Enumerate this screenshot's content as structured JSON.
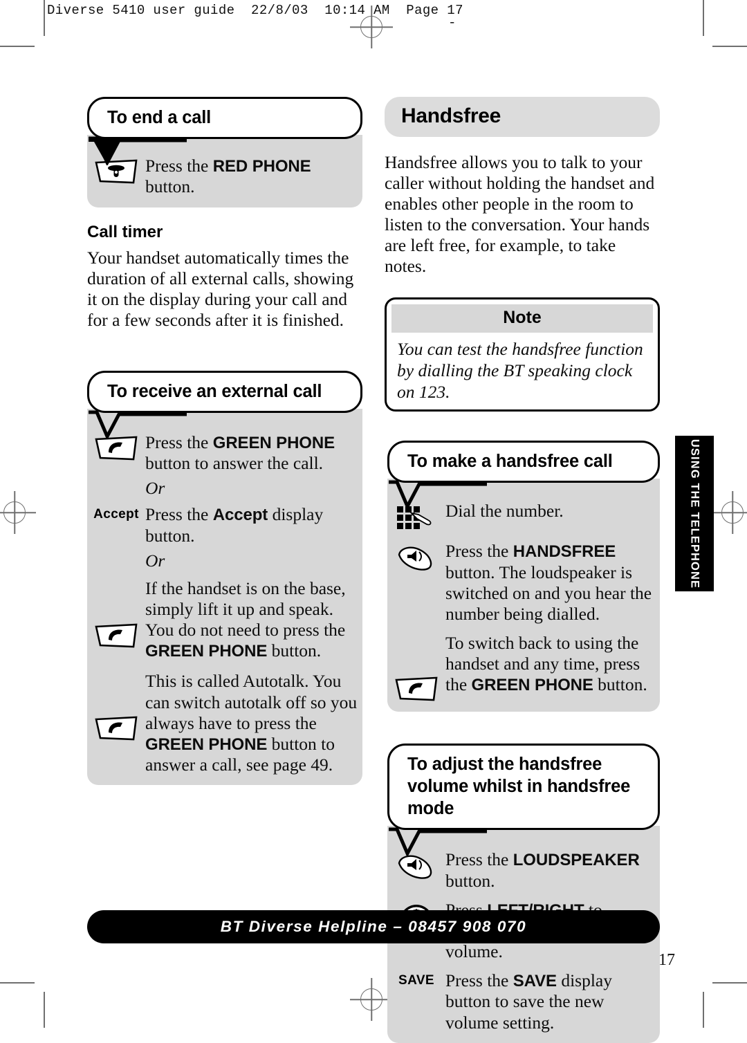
{
  "running_head": "Diverse 5410 user guide  22/8/03  10:14 AM  Page 17",
  "dash_mark": "-",
  "page_number": "17",
  "side_tab": {
    "label": "USING THE TELEPHONE"
  },
  "footer": {
    "text": "BT Diverse Helpline – 08457 908 070"
  },
  "left_column": {
    "section1": {
      "heading": "To end a call",
      "rows": [
        {
          "icon": "red-phone-button-icon",
          "text_parts": [
            {
              "t": "Press the ",
              "style": "normal"
            },
            {
              "t": "RED PHONE",
              "style": "bold"
            },
            {
              "t": " button.",
              "style": "normal"
            }
          ]
        }
      ]
    },
    "call_timer": {
      "subheading": "Call timer",
      "paragraph": "Your handset automatically times the duration of all external calls, showing it on the display during your call and for a few seconds after it is finished."
    },
    "section2": {
      "heading": "To receive an external call",
      "rows": [
        {
          "icon": "green-phone-button-icon",
          "text_parts": [
            {
              "t": "Press the ",
              "style": "normal"
            },
            {
              "t": "GREEN PHONE",
              "style": "bold"
            },
            {
              "t": " button to answer the call.",
              "style": "normal"
            }
          ]
        },
        {
          "icon": "none",
          "text_parts": [
            {
              "t": "Or",
              "style": "italic"
            }
          ]
        },
        {
          "icon": "accept-display-label",
          "icon_label": "Accept",
          "text_parts": [
            {
              "t": "Press the ",
              "style": "normal"
            },
            {
              "t": "Accept",
              "style": "bold"
            },
            {
              "t": " display button.",
              "style": "normal"
            }
          ]
        },
        {
          "icon": "none",
          "text_parts": [
            {
              "t": "Or",
              "style": "italic"
            }
          ]
        },
        {
          "icon": "green-phone-button-icon",
          "text_parts": [
            {
              "t": "If the handset is on the base, simply lift it up and speak. You do not need to press the ",
              "style": "normal"
            },
            {
              "t": "GREEN PHONE",
              "style": "bold"
            },
            {
              "t": " button.",
              "style": "normal"
            }
          ]
        },
        {
          "icon": "green-phone-button-icon",
          "text_parts": [
            {
              "t": "This is called Autotalk. You can switch autotalk off so you always have to press the ",
              "style": "normal"
            },
            {
              "t": "GREEN PHONE",
              "style": "bold"
            },
            {
              "t": " button to answer a call, see page 49.",
              "style": "normal"
            }
          ]
        }
      ]
    }
  },
  "right_column": {
    "title": "Handsfree",
    "intro": "Handsfree allows you to talk to your caller without holding the handset and enables other people in the room to listen to the conversation. Your hands are left free, for example, to take notes.",
    "note": {
      "header": "Note",
      "body": "You can test the handsfree function by dialling the BT speaking clock on 123."
    },
    "section1": {
      "heading": "To make a handsfree call",
      "rows": [
        {
          "icon": "keypad-icon",
          "text_parts": [
            {
              "t": "Dial the number.",
              "style": "normal"
            }
          ]
        },
        {
          "icon": "loudspeaker-icon",
          "text_parts": [
            {
              "t": "Press the ",
              "style": "normal"
            },
            {
              "t": "HANDSFREE",
              "style": "bold"
            },
            {
              "t": " button. The loudspeaker is switched on and you hear the number being dialled.",
              "style": "normal"
            }
          ]
        },
        {
          "icon": "green-phone-button-icon",
          "text_parts": [
            {
              "t": "To switch back to using the handset and any time, press the ",
              "style": "normal"
            },
            {
              "t": "GREEN PHONE",
              "style": "bold"
            },
            {
              "t": " button.",
              "style": "normal"
            }
          ]
        }
      ]
    },
    "section2": {
      "heading": "To adjust the handsfree volume whilst in handsfree mode",
      "rows": [
        {
          "icon": "loudspeaker-icon",
          "text_parts": [
            {
              "t": "Press the ",
              "style": "normal"
            },
            {
              "t": "LOUDSPEAKER",
              "style": "bold"
            },
            {
              "t": " button.",
              "style": "normal"
            }
          ]
        },
        {
          "icon": "navigation-pad-icon",
          "text_parts": [
            {
              "t": "Press ",
              "style": "normal"
            },
            {
              "t": "LEFT/RIGHT",
              "style": "bold"
            },
            {
              "t": " to increase or decrease the volume.",
              "style": "normal"
            }
          ]
        },
        {
          "icon": "save-display-label",
          "icon_label": "SAVE",
          "text_parts": [
            {
              "t": "Press the ",
              "style": "normal"
            },
            {
              "t": "SAVE",
              "style": "bold"
            },
            {
              "t": " display button to save the new volume setting.",
              "style": "normal"
            }
          ]
        }
      ]
    }
  },
  "colors": {
    "strip_grey": "#d7d7d7",
    "head_grey": "#dcdcdc",
    "ink": "#000000"
  }
}
